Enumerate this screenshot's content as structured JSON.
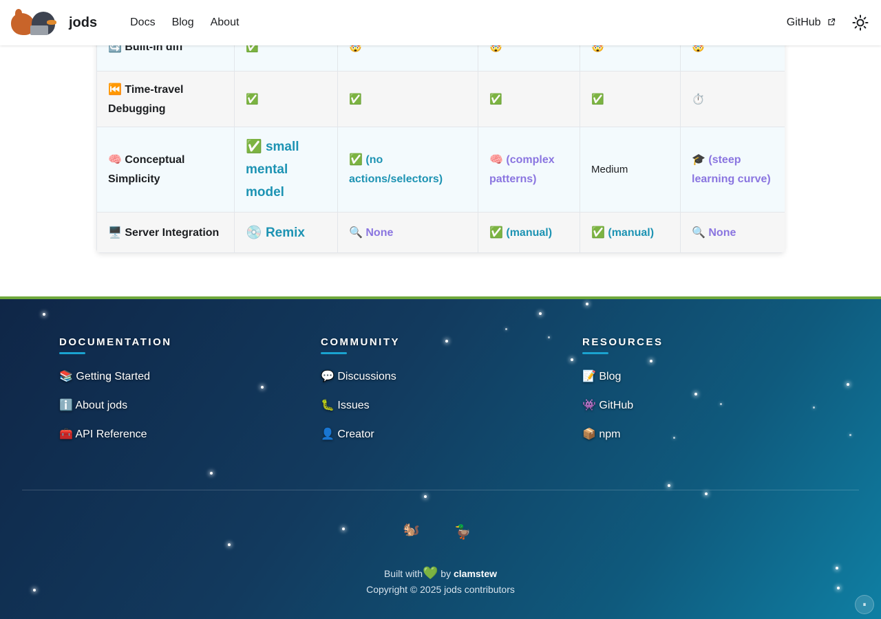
{
  "navbar": {
    "brand_title": "jods",
    "links": [
      "Docs",
      "Blog",
      "About"
    ],
    "github_label": "GitHub"
  },
  "table": {
    "rows": [
      {
        "feature_icon": "🔄",
        "feature": "Built-in diff",
        "cells": [
          {
            "icon": "✅",
            "text": "",
            "style": "plain"
          },
          {
            "icon": "🤯",
            "text": "",
            "style": "plain"
          },
          {
            "icon": "🤯",
            "text": "",
            "style": "plain"
          },
          {
            "icon": "🤯",
            "text": "",
            "style": "plain"
          },
          {
            "icon": "🤯",
            "text": "",
            "style": "plain"
          }
        ]
      },
      {
        "feature_icon": "⏮️",
        "feature": "Time-travel Debugging",
        "cells": [
          {
            "icon": "✅",
            "text": "",
            "style": "plain"
          },
          {
            "icon": "✅",
            "text": "",
            "style": "plain"
          },
          {
            "icon": "✅",
            "text": "",
            "style": "plain"
          },
          {
            "icon": "✅",
            "text": "",
            "style": "plain"
          },
          {
            "icon": "⏱️",
            "text": "",
            "style": "plain"
          }
        ]
      },
      {
        "feature_icon": "🧠",
        "feature": "Conceptual Simplicity",
        "cells": [
          {
            "icon": "✅",
            "text": "small mental model",
            "style": "teal-big"
          },
          {
            "icon": "✅",
            "text": "(no actions/selectors)",
            "style": "teal"
          },
          {
            "icon": "🧠",
            "text": "(complex patterns)",
            "style": "purple"
          },
          {
            "icon": "",
            "text": "Medium",
            "style": "plain"
          },
          {
            "icon": "🎓",
            "text": "(steep learning curve)",
            "style": "purple"
          }
        ]
      },
      {
        "feature_icon": "🖥️",
        "feature": "Server Integration",
        "cells": [
          {
            "icon": "💿",
            "text": "Remix",
            "style": "teal-big"
          },
          {
            "icon": "🔍",
            "text": "None",
            "style": "purple"
          },
          {
            "icon": "✅",
            "text": "(manual)",
            "style": "teal"
          },
          {
            "icon": "✅",
            "text": "(manual)",
            "style": "teal"
          },
          {
            "icon": "🔍",
            "text": "None",
            "style": "purple"
          }
        ]
      }
    ]
  },
  "footer": {
    "columns": [
      {
        "title": "DOCUMENTATION",
        "links": [
          {
            "icon": "📚",
            "label": "Getting Started"
          },
          {
            "icon": "ℹ️",
            "label": "About jods"
          },
          {
            "icon": "🧰",
            "label": "API Reference"
          }
        ]
      },
      {
        "title": "COMMUNITY",
        "links": [
          {
            "icon": "💬",
            "label": "Discussions"
          },
          {
            "icon": "🐛",
            "label": "Issues"
          },
          {
            "icon": "👤",
            "label": "Creator"
          }
        ]
      },
      {
        "title": "RESOURCES",
        "links": [
          {
            "icon": "📝",
            "label": "Blog"
          },
          {
            "icon": "👾",
            "label": "GitHub"
          },
          {
            "icon": "📦",
            "label": "npm"
          }
        ]
      }
    ],
    "mascots": [
      "🐿️",
      "🦆"
    ],
    "built_with": "Built with",
    "heart": "💚",
    "by": "by",
    "author": "clamstew",
    "copyright": "Copyright © 2025 jods contributors",
    "pause_label": "⏸"
  },
  "colors": {
    "accent_teal": "#1d93b3",
    "accent_purple": "#8a75e0",
    "footer_border": "#6fa83c",
    "footer_bg_start": "#0f2647",
    "footer_bg_end": "#0f7fa3"
  }
}
